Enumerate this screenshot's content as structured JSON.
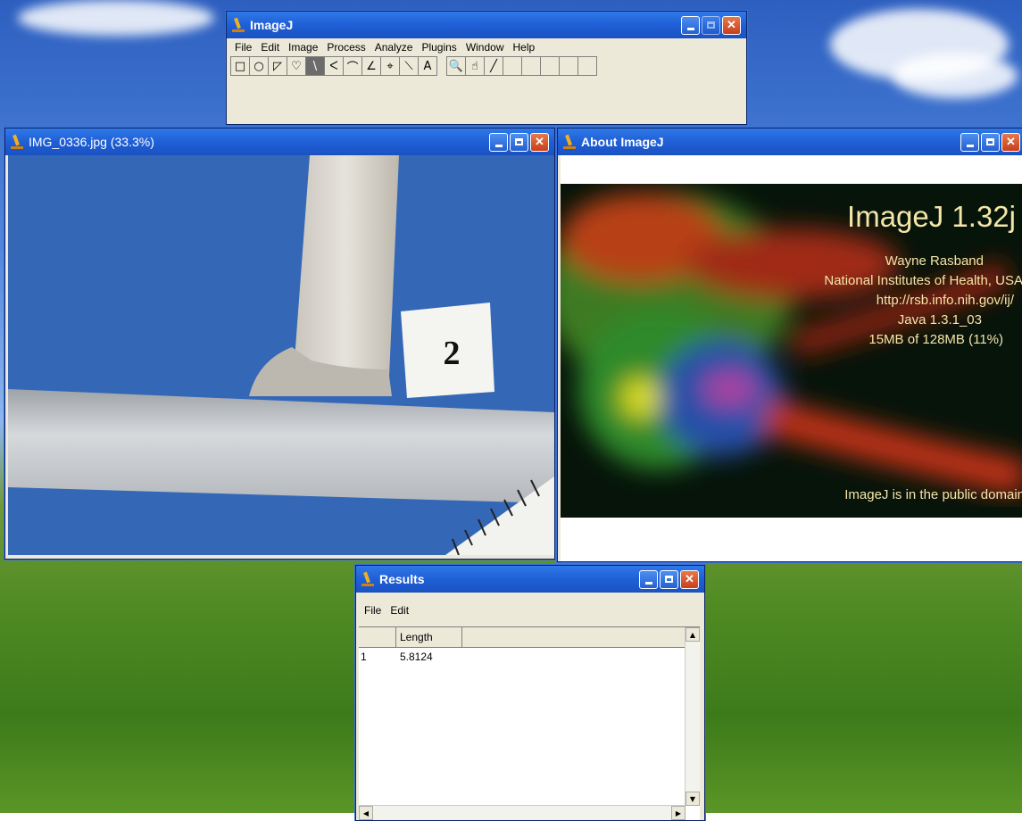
{
  "imagej_main": {
    "title": "ImageJ",
    "menu": [
      "File",
      "Edit",
      "Image",
      "Process",
      "Analyze",
      "Plugins",
      "Window",
      "Help"
    ],
    "tools": [
      {
        "icon": "rectangle-tool-icon",
        "glyph": "□"
      },
      {
        "icon": "oval-tool-icon",
        "glyph": "○"
      },
      {
        "icon": "polygon-tool-icon",
        "glyph": "◸"
      },
      {
        "icon": "freehand-tool-icon",
        "glyph": "♡"
      },
      {
        "icon": "straight-line-tool-icon",
        "glyph": "\\",
        "active": true
      },
      {
        "icon": "segmented-line-tool-icon",
        "glyph": "ᐸ"
      },
      {
        "icon": "freehand-line-tool-icon",
        "glyph": "⌒"
      },
      {
        "icon": "angle-tool-icon",
        "glyph": "∠"
      },
      {
        "icon": "point-tool-icon",
        "glyph": "⌖"
      },
      {
        "icon": "wand-tool-icon",
        "glyph": "⟍"
      },
      {
        "icon": "text-tool-icon",
        "glyph": "A"
      },
      {
        "icon": "gap",
        "glyph": ""
      },
      {
        "icon": "magnifier-tool-icon",
        "glyph": "🔍"
      },
      {
        "icon": "hand-tool-icon",
        "glyph": "☝"
      },
      {
        "icon": "dropper-tool-icon",
        "glyph": "╱"
      },
      {
        "icon": "empty-tool-slot-icon",
        "glyph": ""
      },
      {
        "icon": "empty-tool-slot-icon",
        "glyph": ""
      },
      {
        "icon": "empty-tool-slot-icon",
        "glyph": ""
      },
      {
        "icon": "empty-tool-slot-icon",
        "glyph": ""
      },
      {
        "icon": "empty-tool-slot-icon",
        "glyph": ""
      }
    ]
  },
  "image_window": {
    "title": "IMG_0336.jpg (33.3%)",
    "label_card": "2"
  },
  "about_window": {
    "title": "About ImageJ",
    "heading": "ImageJ 1.32j",
    "author": "Wayne Rasband",
    "institution": "National Institutes of Health, USA",
    "url": "http://rsb.info.nih.gov/ij/",
    "java": "Java 1.3.1_03",
    "memory": "15MB of 128MB (11%)",
    "footer": "ImageJ is in the public domain"
  },
  "results_window": {
    "title": "Results",
    "menu": [
      "File",
      "Edit"
    ],
    "columns": [
      "",
      "Length"
    ],
    "rows": [
      [
        "1",
        "5.8124"
      ]
    ]
  }
}
